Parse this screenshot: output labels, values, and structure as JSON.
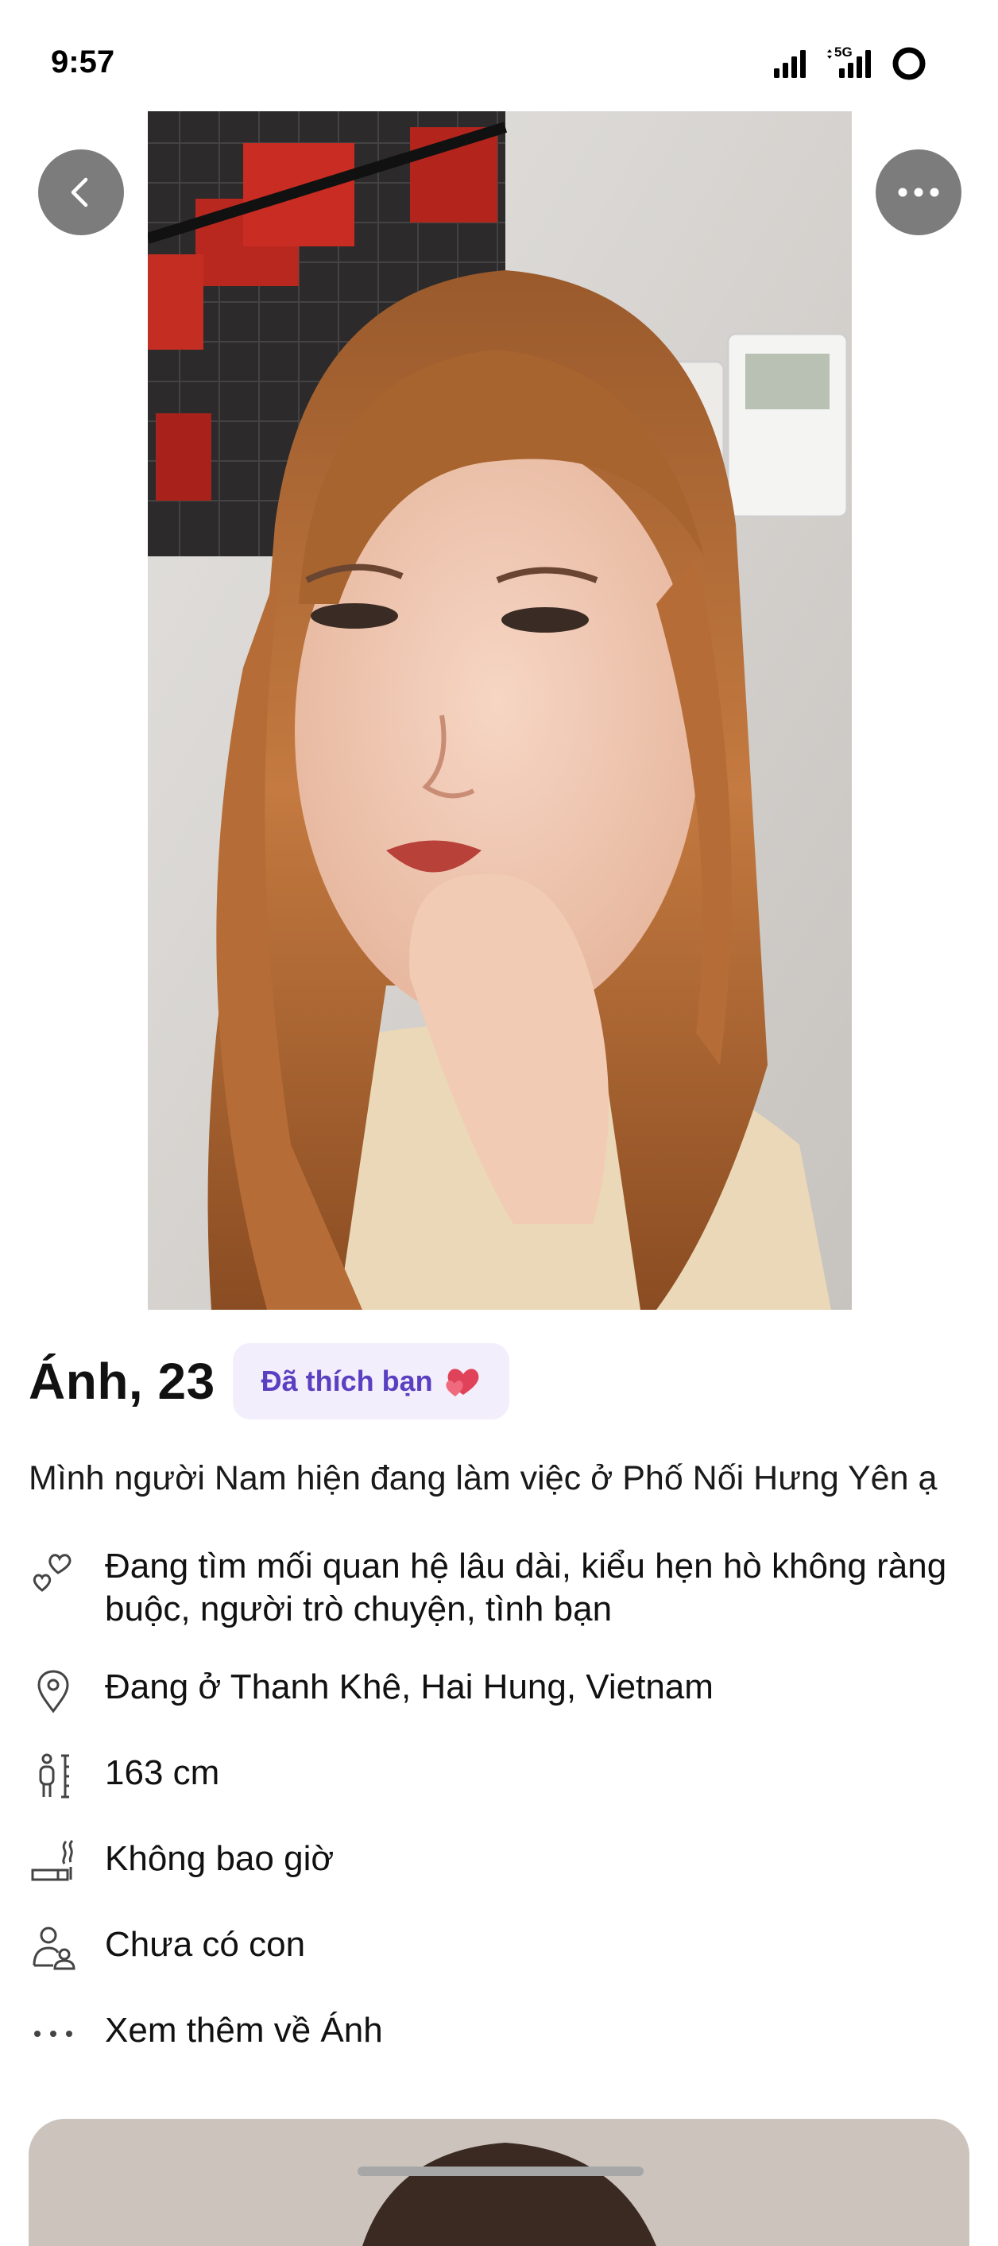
{
  "status_bar": {
    "time": "9:57",
    "network": "5G",
    "icons": [
      "signal-icon",
      "cellular-5g-icon",
      "battery-ring-icon"
    ]
  },
  "profile": {
    "name_age": "Ánh, 23",
    "badge_label": "Đã thích bạn",
    "badge_icon": "hearts-icon",
    "bio": "Mình người Nam hiện đang làm việc ở Phố Nối Hưng Yên ạ",
    "info": [
      {
        "icon": "relationship-hearts-icon",
        "text": "Đang tìm mối quan hệ lâu dài, kiểu hẹn hò không ràng buộc, người trò chuyện, tình bạn"
      },
      {
        "icon": "location-pin-icon",
        "text": "Đang ở Thanh Khê, Hai Hung, Vietnam"
      },
      {
        "icon": "height-icon",
        "text": "163 cm"
      },
      {
        "icon": "smoking-icon",
        "text": "Không bao giờ"
      },
      {
        "icon": "children-icon",
        "text": "Chưa có con"
      },
      {
        "icon": "more-dots-icon",
        "text": "Xem thêm về Ánh"
      }
    ]
  },
  "colors": {
    "badge_bg": "#f2eefc",
    "badge_text": "#5a3fc0",
    "heart": "#e0425a",
    "button_bg": "#5f5f5f"
  }
}
